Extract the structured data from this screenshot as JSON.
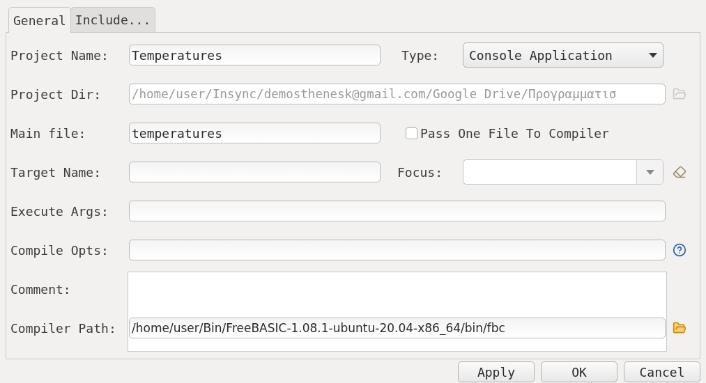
{
  "tabs": [
    {
      "label": "General",
      "selected": true
    },
    {
      "label": "Include...",
      "selected": false
    }
  ],
  "project_name": {
    "label": "Project Name:",
    "value": "Temperatures"
  },
  "type": {
    "label": "Type:",
    "value": "Console Application"
  },
  "project_dir": {
    "label": "Project Dir:",
    "value": "/home/user/Insync/demosthenesk@gmail.com/Google Drive/Προγραμματισ",
    "disabled": true
  },
  "main_file": {
    "label": "Main file:",
    "value": "temperatures"
  },
  "pass_one_file": {
    "label": "Pass One File To Compiler",
    "checked": false
  },
  "target_name": {
    "label": "Target Name:"
  },
  "focus": {
    "label": "Focus:"
  },
  "execute_args": {
    "label": "Execute Args:"
  },
  "compile_opts": {
    "label": "Compile Opts:"
  },
  "comment": {
    "label": "Comment:"
  },
  "compiler_path": {
    "label": "Compiler Path:",
    "value": "/home/user/Bin/FreeBASIC-1.08.1-ubuntu-20.04-x86_64/bin/fbc"
  },
  "buttons": [
    "Apply",
    "OK",
    "Cancel"
  ]
}
